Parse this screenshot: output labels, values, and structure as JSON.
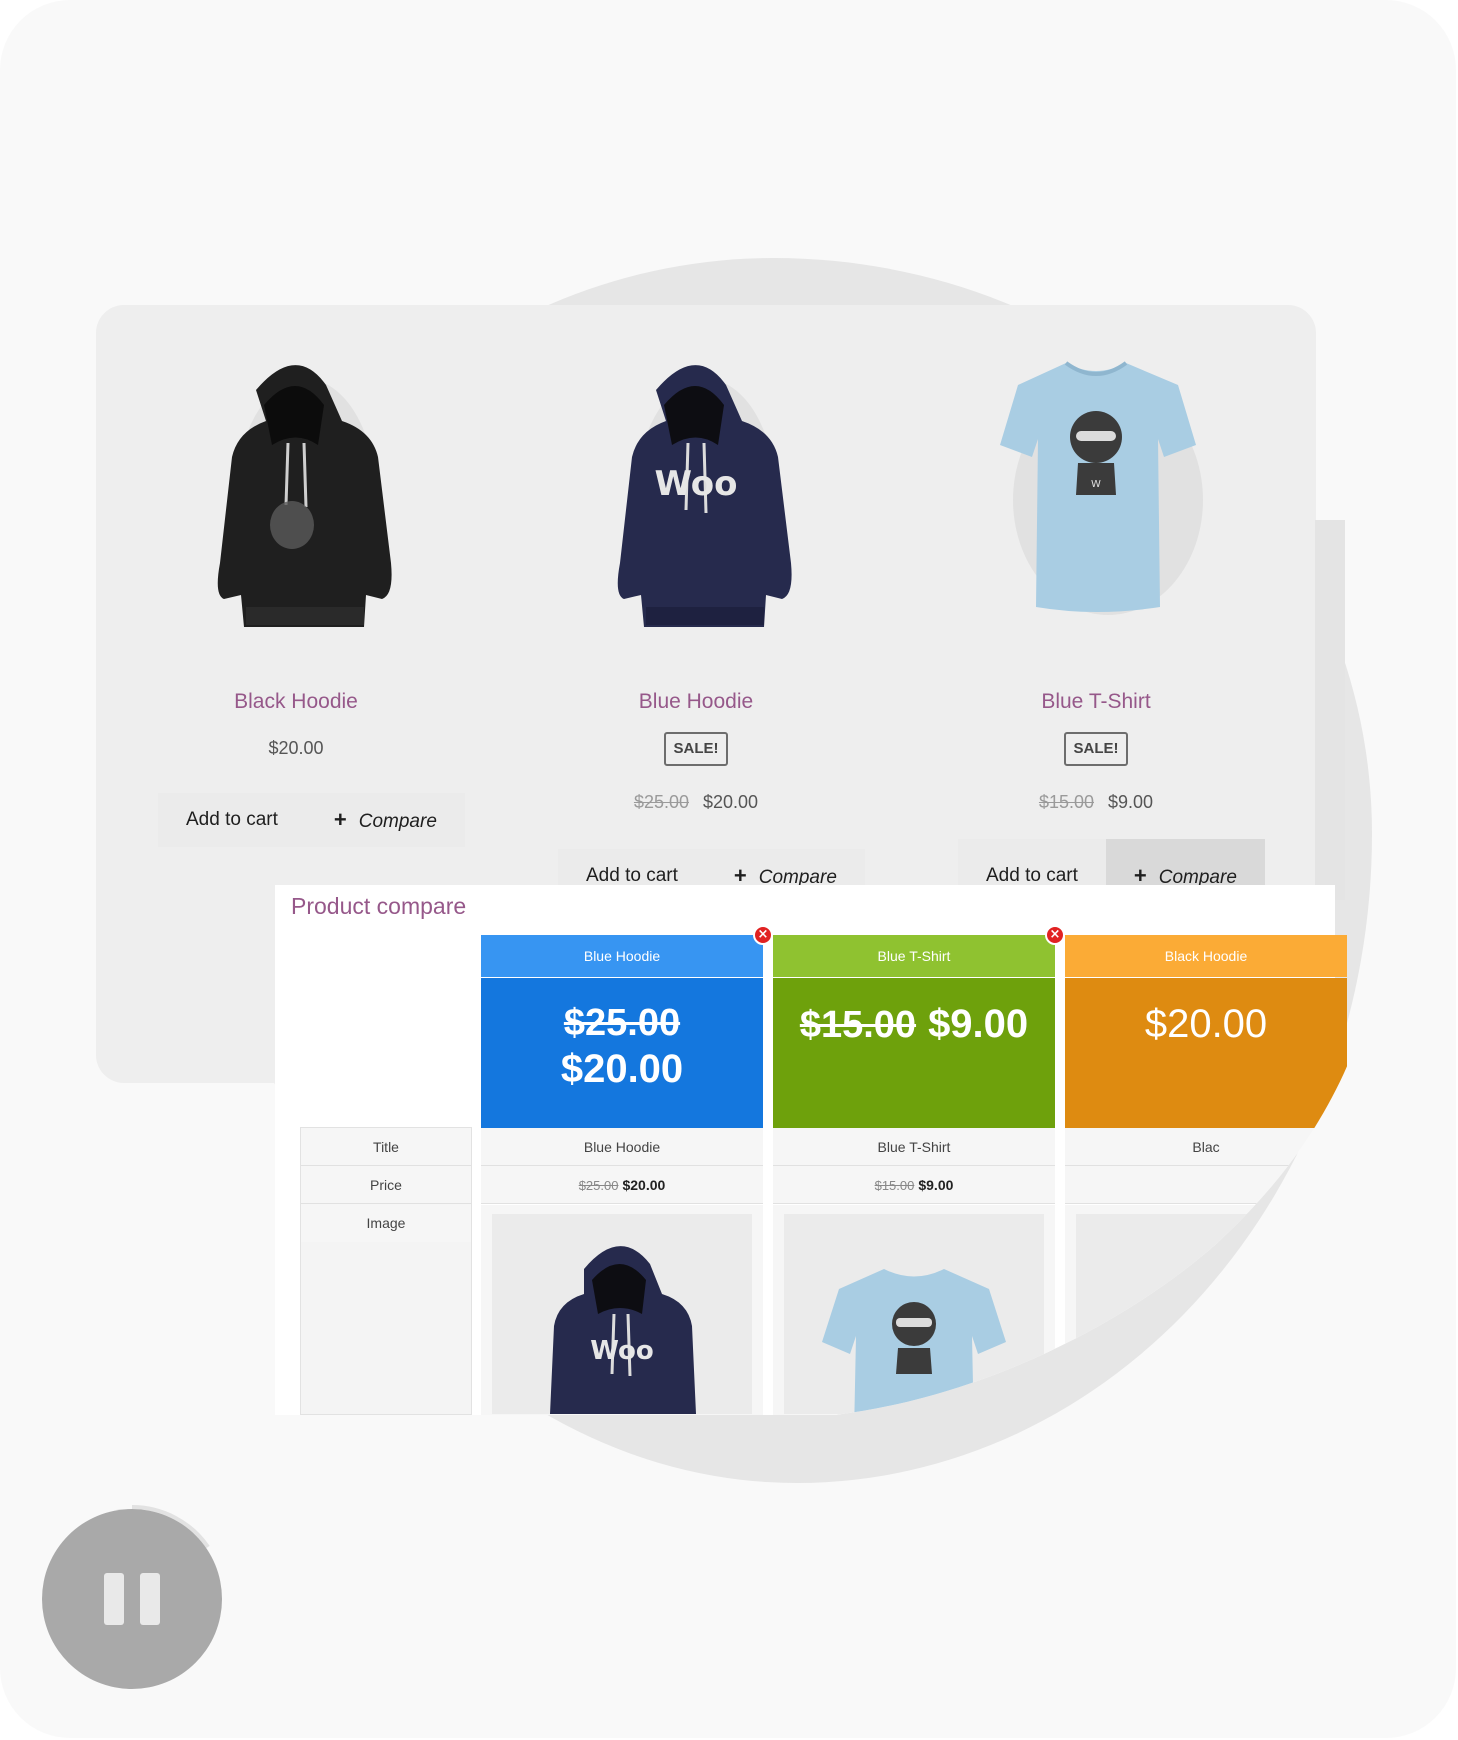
{
  "products": [
    {
      "title": "Black Hoodie",
      "price": "$20.00",
      "add_to_cart": "Add to cart",
      "compare": "Compare"
    },
    {
      "title": "Blue Hoodie",
      "badge": "SALE!",
      "old_price": "$25.00",
      "price": "$20.00",
      "add_to_cart": "Add to cart",
      "compare": "Compare"
    },
    {
      "title": "Blue T-Shirt",
      "badge": "SALE!",
      "old_price": "$15.00",
      "price": "$9.00",
      "add_to_cart": "Add to cart",
      "compare": "Compare"
    }
  ],
  "compare_panel": {
    "heading": "Product compare",
    "row_labels": [
      "Title",
      "Price",
      "Image"
    ],
    "columns": [
      {
        "name": "Blue Hoodie",
        "old_price": "$25.00",
        "price": "$20.00",
        "head_color": "#3795f2",
        "price_color": "#1477de"
      },
      {
        "name": "Blue T-Shirt",
        "old_price": "$15.00",
        "price": "$9.00",
        "head_color": "#8fc230",
        "price_color": "#6ea10c"
      },
      {
        "name": "Black Hoodie",
        "price": "$20.00",
        "head_color": "#fbab36",
        "price_color": "#de8b11",
        "title_cell": "Blac"
      }
    ],
    "remove_icon": "remove-x-icon"
  },
  "player": {
    "icon": "pause-icon"
  }
}
